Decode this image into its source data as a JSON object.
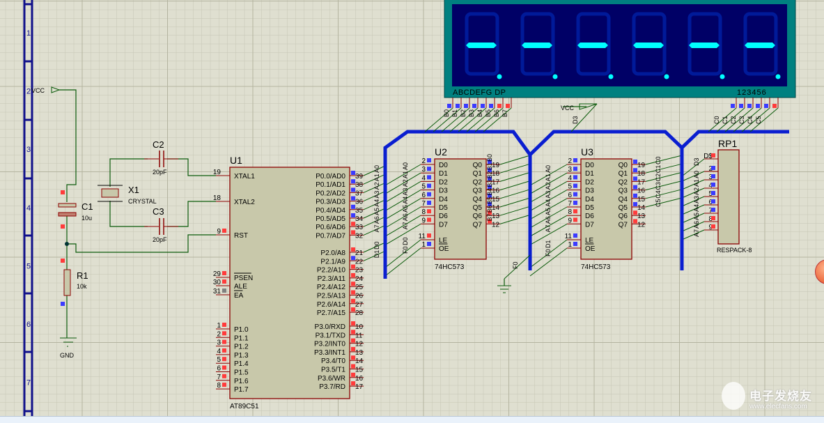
{
  "colors": {
    "background": "#dfdfd0",
    "wire": "#0a5a0a",
    "bus": "#0a1ed0",
    "body": "#c8c8aa",
    "outline": "#8b0000",
    "pin_high": "#ff3b3b",
    "pin_low": "#3b3bff",
    "pin_float": "#808080",
    "display_frame": "#008080",
    "display_face": "#000066",
    "segment_on": "#00ffff",
    "segment_off": "#001a99"
  },
  "ruler": {
    "labels": [
      "1",
      "2",
      "3",
      "4",
      "5",
      "6",
      "7"
    ]
  },
  "display": {
    "segment_label": "ABCDEFG  DP",
    "digit_label": "123456",
    "digits": 6,
    "lit_segment": "G",
    "dp_lit": true,
    "seg_pins": [
      {
        "net": "B0",
        "state": "low"
      },
      {
        "net": "B1",
        "state": "low"
      },
      {
        "net": "B2",
        "state": "low"
      },
      {
        "net": "B3",
        "state": "low"
      },
      {
        "net": "B4",
        "state": "low"
      },
      {
        "net": "B5",
        "state": "low"
      },
      {
        "net": "B6",
        "state": "high"
      },
      {
        "net": "B7",
        "state": "high"
      }
    ],
    "digit_pins": [
      {
        "net": "C0",
        "state": "low"
      },
      {
        "net": "C1",
        "state": "low"
      },
      {
        "net": "C2",
        "state": "low"
      },
      {
        "net": "C3",
        "state": "low"
      },
      {
        "net": "C4",
        "state": "low"
      },
      {
        "net": "C5",
        "state": "high"
      }
    ]
  },
  "power": {
    "vcc1": "VCC",
    "vcc2": "VCC",
    "vcc2_net": "D3",
    "gnd": "GND"
  },
  "components": {
    "c1": {
      "ref": "C1",
      "value": "10u"
    },
    "c2": {
      "ref": "C2",
      "value": "20pF"
    },
    "c3": {
      "ref": "C3",
      "value": "20pF"
    },
    "x1": {
      "ref": "X1",
      "value": "CRYSTAL"
    },
    "r1": {
      "ref": "R1",
      "value": "10k"
    },
    "rp1": {
      "ref": "RP1",
      "value": "RESPACK-8"
    }
  },
  "u1": {
    "ref": "U1",
    "part": "AT89C51",
    "left": [
      {
        "n": "19",
        "name": "XTAL1",
        "state": "none"
      },
      {
        "n": "18",
        "name": "XTAL2",
        "state": "none"
      },
      {
        "n": "9",
        "name": "RST",
        "state": "high"
      },
      {
        "n": "29",
        "name": "PSEN",
        "state": "high",
        "bar": true
      },
      {
        "n": "30",
        "name": "ALE",
        "state": "high"
      },
      {
        "n": "31",
        "name": "EA",
        "state": "float",
        "bar": true
      },
      {
        "n": "1",
        "name": "P1.0",
        "state": "high"
      },
      {
        "n": "2",
        "name": "P1.1",
        "state": "high"
      },
      {
        "n": "3",
        "name": "P1.2",
        "state": "high"
      },
      {
        "n": "4",
        "name": "P1.3",
        "state": "high"
      },
      {
        "n": "5",
        "name": "P1.4",
        "state": "high"
      },
      {
        "n": "6",
        "name": "P1.5",
        "state": "high"
      },
      {
        "n": "7",
        "name": "P1.6",
        "state": "high"
      },
      {
        "n": "8",
        "name": "P1.7",
        "state": "high"
      }
    ],
    "right": [
      {
        "n": "39",
        "name": "P0.0/AD0",
        "state": "low",
        "net": "A0"
      },
      {
        "n": "38",
        "name": "P0.1/AD1",
        "state": "low",
        "net": "A1"
      },
      {
        "n": "37",
        "name": "P0.2/AD2",
        "state": "low",
        "net": "A2"
      },
      {
        "n": "36",
        "name": "P0.3/AD3",
        "state": "low",
        "net": "A3"
      },
      {
        "n": "35",
        "name": "P0.4/AD4",
        "state": "low",
        "net": "A4"
      },
      {
        "n": "34",
        "name": "P0.5/AD5",
        "state": "low",
        "net": "A5"
      },
      {
        "n": "33",
        "name": "P0.6/AD6",
        "state": "high",
        "net": "A6"
      },
      {
        "n": "32",
        "name": "P0.7/AD7",
        "state": "high",
        "net": "A7"
      },
      {
        "n": "21",
        "name": "P2.0/A8",
        "state": "high",
        "net": "D0"
      },
      {
        "n": "22",
        "name": "P2.1/A9",
        "state": "low",
        "net": "D1"
      },
      {
        "n": "23",
        "name": "P2.2/A10",
        "state": "high"
      },
      {
        "n": "24",
        "name": "P2.3/A11",
        "state": "high"
      },
      {
        "n": "25",
        "name": "P2.4/A12",
        "state": "high"
      },
      {
        "n": "26",
        "name": "P2.5/A13",
        "state": "high"
      },
      {
        "n": "27",
        "name": "P2.6/A14",
        "state": "high"
      },
      {
        "n": "28",
        "name": "P2.7/A15",
        "state": "high"
      },
      {
        "n": "10",
        "name": "P3.0/RXD",
        "state": "high"
      },
      {
        "n": "11",
        "name": "P3.1/TXD",
        "state": "high"
      },
      {
        "n": "12",
        "name": "P3.2/INT0",
        "state": "high"
      },
      {
        "n": "13",
        "name": "P3.3/INT1",
        "state": "high"
      },
      {
        "n": "14",
        "name": "P3.4/T0",
        "state": "high"
      },
      {
        "n": "15",
        "name": "P3.5/T1",
        "state": "high"
      },
      {
        "n": "16",
        "name": "P3.6/WR",
        "state": "high"
      },
      {
        "n": "17",
        "name": "P3.7/RD",
        "state": "high"
      }
    ]
  },
  "u2": {
    "ref": "U2",
    "part": "74HC573",
    "left": [
      {
        "n": "2",
        "name": "D0",
        "state": "low",
        "net": "A0"
      },
      {
        "n": "3",
        "name": "D1",
        "state": "low",
        "net": "A1"
      },
      {
        "n": "4",
        "name": "D2",
        "state": "low",
        "net": "A2"
      },
      {
        "n": "5",
        "name": "D3",
        "state": "low",
        "net": "A3"
      },
      {
        "n": "6",
        "name": "D4",
        "state": "low",
        "net": "A4"
      },
      {
        "n": "7",
        "name": "D5",
        "state": "low",
        "net": "A5"
      },
      {
        "n": "8",
        "name": "D6",
        "state": "high",
        "net": "A6"
      },
      {
        "n": "9",
        "name": "D7",
        "state": "high",
        "net": "A7"
      },
      {
        "n": "11",
        "name": "LE",
        "state": "high",
        "net": "D0"
      },
      {
        "n": "1",
        "name": "OE",
        "state": "low",
        "net": "F0",
        "bar": true
      }
    ],
    "right": [
      {
        "n": "19",
        "name": "Q0",
        "state": "low",
        "net": "B0"
      },
      {
        "n": "18",
        "name": "Q1",
        "state": "low",
        "net": "B1"
      },
      {
        "n": "17",
        "name": "Q2",
        "state": "low",
        "net": "B2"
      },
      {
        "n": "16",
        "name": "Q3",
        "state": "low",
        "net": "B3"
      },
      {
        "n": "15",
        "name": "Q4",
        "state": "low",
        "net": "B4"
      },
      {
        "n": "14",
        "name": "Q5",
        "state": "low",
        "net": "B5"
      },
      {
        "n": "13",
        "name": "Q6",
        "state": "high",
        "net": "B6"
      },
      {
        "n": "12",
        "name": "Q7",
        "state": "high",
        "net": "B7"
      }
    ]
  },
  "u3": {
    "ref": "U3",
    "part": "74HC573",
    "gnd_net": "F0",
    "left": [
      {
        "n": "2",
        "name": "D0",
        "state": "low",
        "net": "A0"
      },
      {
        "n": "3",
        "name": "D1",
        "state": "low",
        "net": "A1"
      },
      {
        "n": "4",
        "name": "D2",
        "state": "low",
        "net": "A2"
      },
      {
        "n": "5",
        "name": "D3",
        "state": "low",
        "net": "A3"
      },
      {
        "n": "6",
        "name": "D4",
        "state": "low",
        "net": "A4"
      },
      {
        "n": "7",
        "name": "D5",
        "state": "low",
        "net": "A5"
      },
      {
        "n": "8",
        "name": "D6",
        "state": "high",
        "net": "A6"
      },
      {
        "n": "9",
        "name": "D7",
        "state": "high",
        "net": "A7"
      },
      {
        "n": "11",
        "name": "LE",
        "state": "low",
        "net": "D1"
      },
      {
        "n": "1",
        "name": "OE",
        "state": "low",
        "net": "F0",
        "bar": true
      }
    ],
    "right": [
      {
        "n": "19",
        "name": "Q0",
        "state": "low",
        "net": "C0"
      },
      {
        "n": "18",
        "name": "Q1",
        "state": "low",
        "net": "C1"
      },
      {
        "n": "17",
        "name": "Q2",
        "state": "low",
        "net": "C2"
      },
      {
        "n": "16",
        "name": "Q3",
        "state": "low",
        "net": "C3"
      },
      {
        "n": "15",
        "name": "Q4",
        "state": "low",
        "net": "C4"
      },
      {
        "n": "14",
        "name": "Q5",
        "state": "low",
        "net": "C5"
      },
      {
        "n": "13",
        "name": "Q6",
        "state": "high"
      },
      {
        "n": "12",
        "name": "Q7",
        "state": "high"
      }
    ]
  },
  "rp1_pins": [
    {
      "n": "1",
      "label": "D$",
      "state": "high",
      "net": "D3"
    },
    {
      "n": "2",
      "state": "low",
      "net": "A0"
    },
    {
      "n": "3",
      "state": "low",
      "net": "A1"
    },
    {
      "n": "4",
      "state": "low",
      "net": "A2"
    },
    {
      "n": "5",
      "state": "low",
      "net": "A3"
    },
    {
      "n": "6",
      "state": "low",
      "net": "A4"
    },
    {
      "n": "7",
      "state": "low",
      "net": "A5"
    },
    {
      "n": "8",
      "state": "high",
      "net": "A6"
    },
    {
      "n": "9",
      "state": "high",
      "net": "A7"
    }
  ],
  "watermark": {
    "cn": "电子发烧友",
    "url": "www.elecfans.com"
  }
}
